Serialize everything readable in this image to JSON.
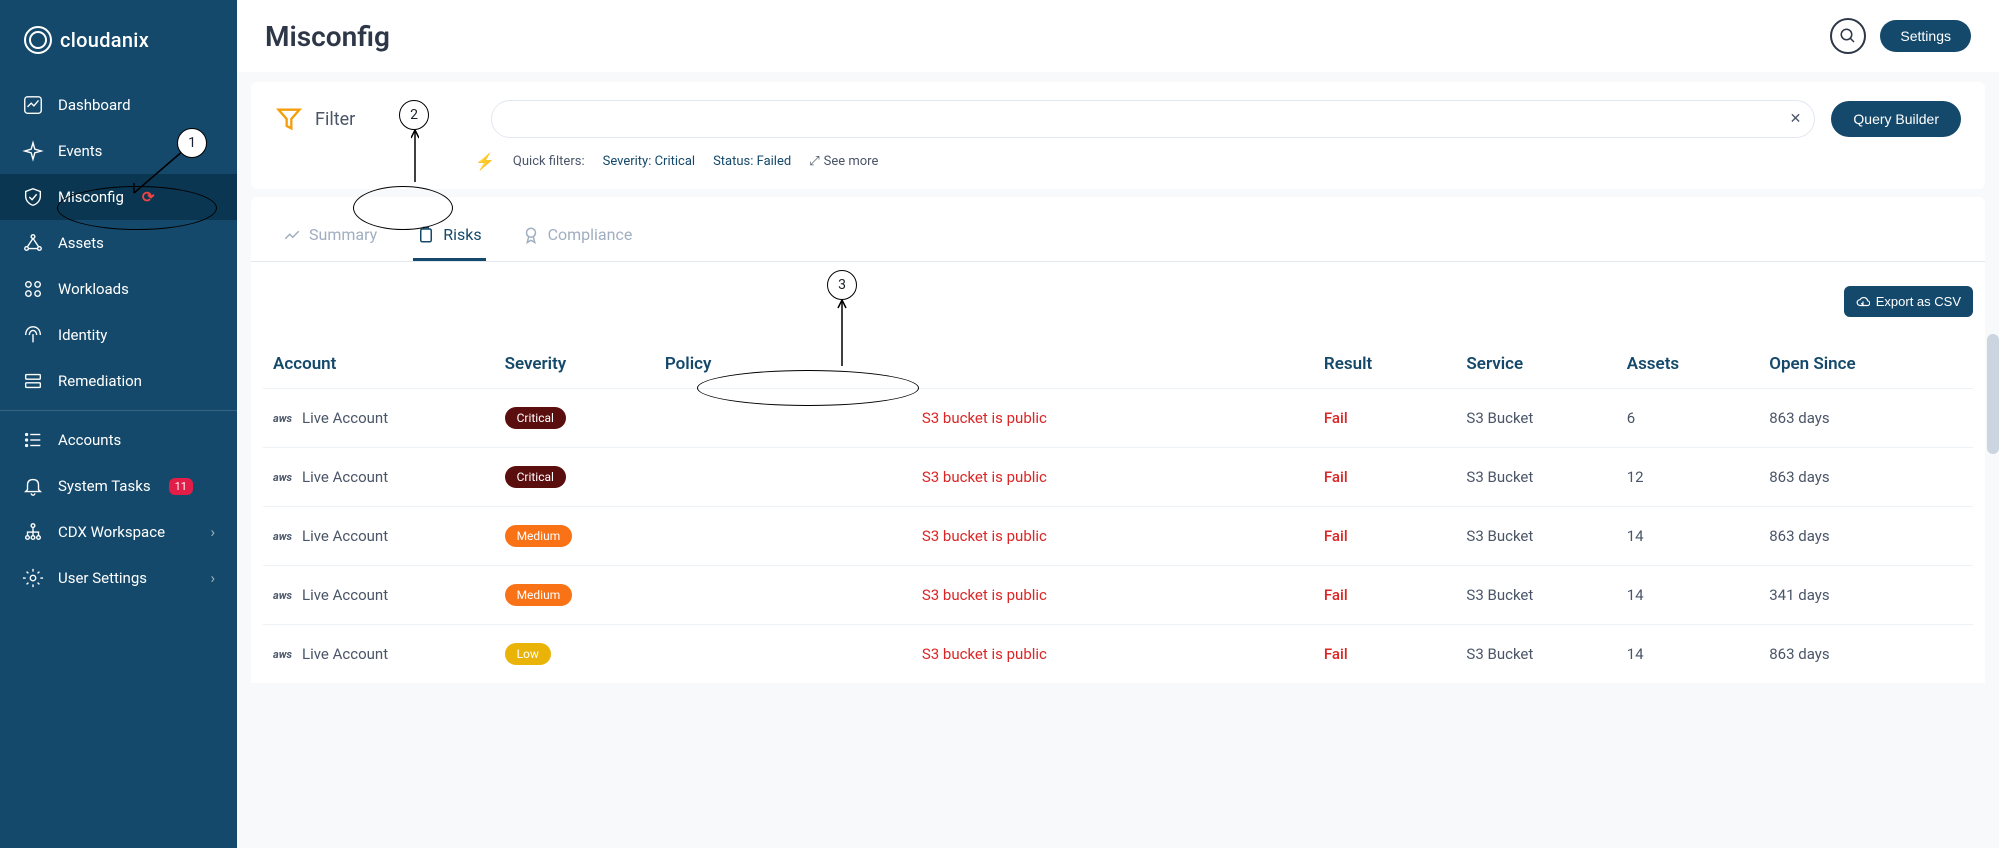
{
  "brand": "cloudanix",
  "page_title": "Misconfig",
  "top": {
    "settings": "Settings"
  },
  "sidebar": {
    "items": [
      {
        "label": "Dashboard"
      },
      {
        "label": "Events"
      },
      {
        "label": "Misconfig"
      },
      {
        "label": "Assets"
      },
      {
        "label": "Workloads"
      },
      {
        "label": "Identity"
      },
      {
        "label": "Remediation"
      },
      {
        "label": "Accounts"
      },
      {
        "label": "System Tasks",
        "badge": "11"
      },
      {
        "label": "CDX Workspace"
      },
      {
        "label": "User Settings"
      }
    ]
  },
  "filter": {
    "label": "Filter",
    "placeholder": "",
    "query_builder": "Query Builder",
    "quick_label": "Quick filters:",
    "chips": [
      "Severity: Critical",
      "Status: Failed"
    ],
    "see_more": "See more"
  },
  "tabs": {
    "summary": "Summary",
    "risks": "Risks",
    "compliance": "Compliance"
  },
  "export_label": "Export as CSV",
  "columns": {
    "account": "Account",
    "severity": "Severity",
    "policy": "Policy",
    "result": "Result",
    "service": "Service",
    "assets": "Assets",
    "open_since": "Open Since"
  },
  "rows": [
    {
      "account": "Live Account",
      "severity": "Critical",
      "sev_class": "critical",
      "policy": "S3 bucket is public",
      "result": "Fail",
      "service": "S3 Bucket",
      "assets": "6",
      "open_since": "863 days"
    },
    {
      "account": "Live Account",
      "severity": "Critical",
      "sev_class": "critical",
      "policy": "S3 bucket is public",
      "result": "Fail",
      "service": "S3 Bucket",
      "assets": "12",
      "open_since": "863 days"
    },
    {
      "account": "Live Account",
      "severity": "Medium",
      "sev_class": "medium",
      "policy": "S3 bucket is public",
      "result": "Fail",
      "service": "S3 Bucket",
      "assets": "14",
      "open_since": "863 days"
    },
    {
      "account": "Live Account",
      "severity": "Medium",
      "sev_class": "medium",
      "policy": "S3 bucket is public",
      "result": "Fail",
      "service": "S3 Bucket",
      "assets": "14",
      "open_since": "341 days"
    },
    {
      "account": "Live Account",
      "severity": "Low",
      "sev_class": "low",
      "policy": "S3 bucket is public",
      "result": "Fail",
      "service": "S3 Bucket",
      "assets": "14",
      "open_since": "863 days"
    }
  ],
  "annotations": {
    "a1": "1",
    "a2": "2",
    "a3": "3"
  }
}
